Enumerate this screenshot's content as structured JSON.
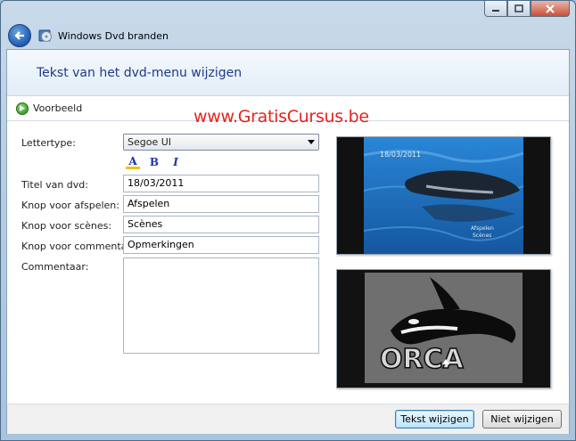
{
  "window": {
    "title": "Windows Dvd branden",
    "minimize_icon": "minimize-icon",
    "maximize_icon": "maximize-icon",
    "close_icon": "close-icon"
  },
  "header": {
    "title": "Tekst van het dvd-menu wijzigen"
  },
  "toolbar": {
    "preview_label": "Voorbeeld"
  },
  "watermark": "www.GratisCursus.be",
  "form": {
    "font_label": "Lettertype:",
    "font_value": "Segoe UI",
    "format_buttons": {
      "color": "A",
      "bold": "B",
      "italic": "I"
    },
    "title_label": "Titel van dvd:",
    "title_value": "18/03/2011",
    "play_label": "Knop voor afspelen:",
    "play_value": "Afspelen",
    "scenes_label": "Knop voor scènes:",
    "scenes_value": "Scènes",
    "notes_label": "Knop voor commentaar:",
    "notes_value": "Opmerkingen",
    "comment_label": "Commentaar:",
    "comment_value": ""
  },
  "preview": {
    "date_text": "18/03/2011",
    "play_text": "Afspelen",
    "scenes_text": "Scènes",
    "logo_text": "ORCA"
  },
  "buttons": {
    "change": "Tekst wijzigen",
    "cancel": "Niet wijzigen"
  },
  "colors": {
    "heading": "#1e3a8a",
    "watermark": "#e8231c",
    "water": "#1f6fb8"
  }
}
